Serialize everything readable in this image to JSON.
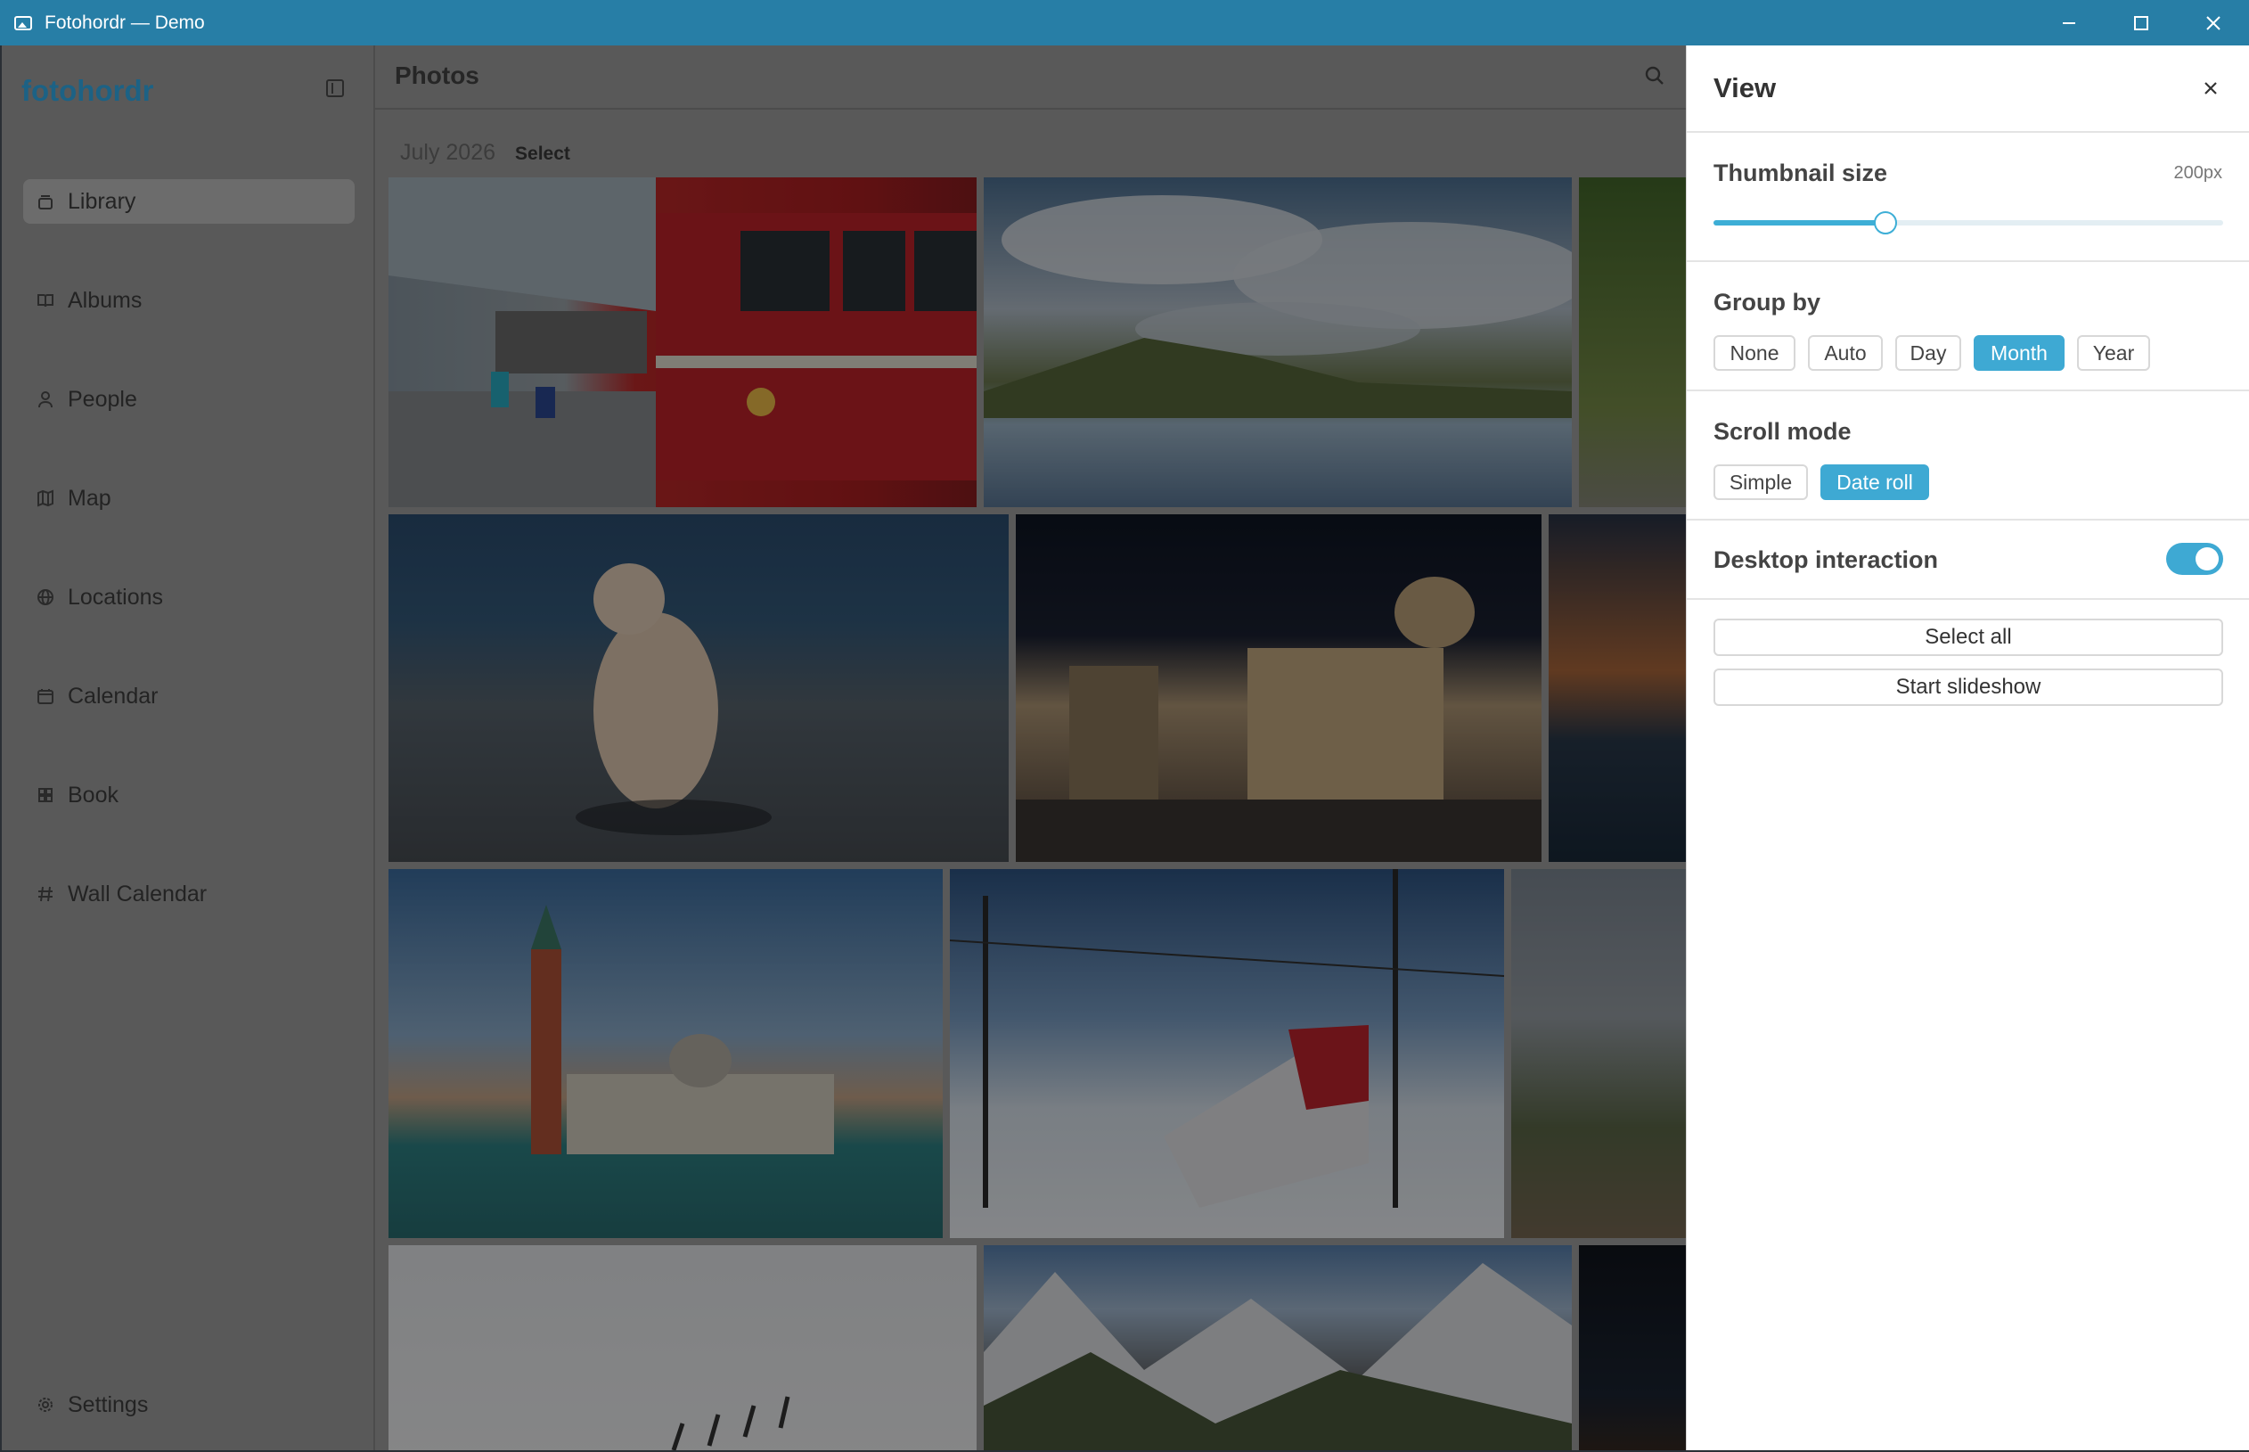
{
  "window": {
    "title": "Fotohordr — Demo"
  },
  "sidebar": {
    "brand": "fotohordr",
    "items": [
      {
        "label": "Library",
        "icon": "library-icon",
        "active": true
      },
      {
        "label": "Albums",
        "icon": "book-open-icon",
        "active": false
      },
      {
        "label": "People",
        "icon": "person-icon",
        "active": false
      },
      {
        "label": "Map",
        "icon": "map-icon",
        "active": false
      },
      {
        "label": "Locations",
        "icon": "globe-icon",
        "active": false
      },
      {
        "label": "Calendar",
        "icon": "calendar-icon",
        "active": false
      },
      {
        "label": "Book",
        "icon": "grid-icon",
        "active": false
      },
      {
        "label": "Wall Calendar",
        "icon": "hash-icon",
        "active": false
      }
    ],
    "settings_label": "Settings"
  },
  "main": {
    "title": "Photos",
    "group": {
      "date": "July 2026",
      "select_label": "Select"
    },
    "photos": [
      {
        "subject": "red train at snowy station"
      },
      {
        "subject": "mountain lake with clouds"
      },
      {
        "subject": "green hillside"
      },
      {
        "subject": "cat on pavement"
      },
      {
        "subject": "cathedral square at night"
      },
      {
        "subject": "sunset over water"
      },
      {
        "subject": "venice bell tower"
      },
      {
        "subject": "train in snow"
      },
      {
        "subject": "railway field"
      },
      {
        "subject": "snowy fence"
      },
      {
        "subject": "snowy mountains"
      },
      {
        "subject": "city at night"
      }
    ]
  },
  "panel": {
    "title": "View",
    "thumbnail": {
      "label": "Thumbnail size",
      "value_text": "200px",
      "level": 0.335
    },
    "group_by": {
      "label": "Group by",
      "options": [
        "None",
        "Auto",
        "Day",
        "Month",
        "Year"
      ],
      "selected": "Month"
    },
    "scroll_mode": {
      "label": "Scroll mode",
      "options": [
        "Simple",
        "Date roll"
      ],
      "selected": "Date roll"
    },
    "desktop_interaction": {
      "label": "Desktop interaction",
      "enabled": true
    },
    "select_all_label": "Select all",
    "slideshow_label": "Start slideshow"
  },
  "colors": {
    "accent": "#3ea9d3",
    "titlebar": "#277ea6",
    "brand": "#1c6285"
  }
}
